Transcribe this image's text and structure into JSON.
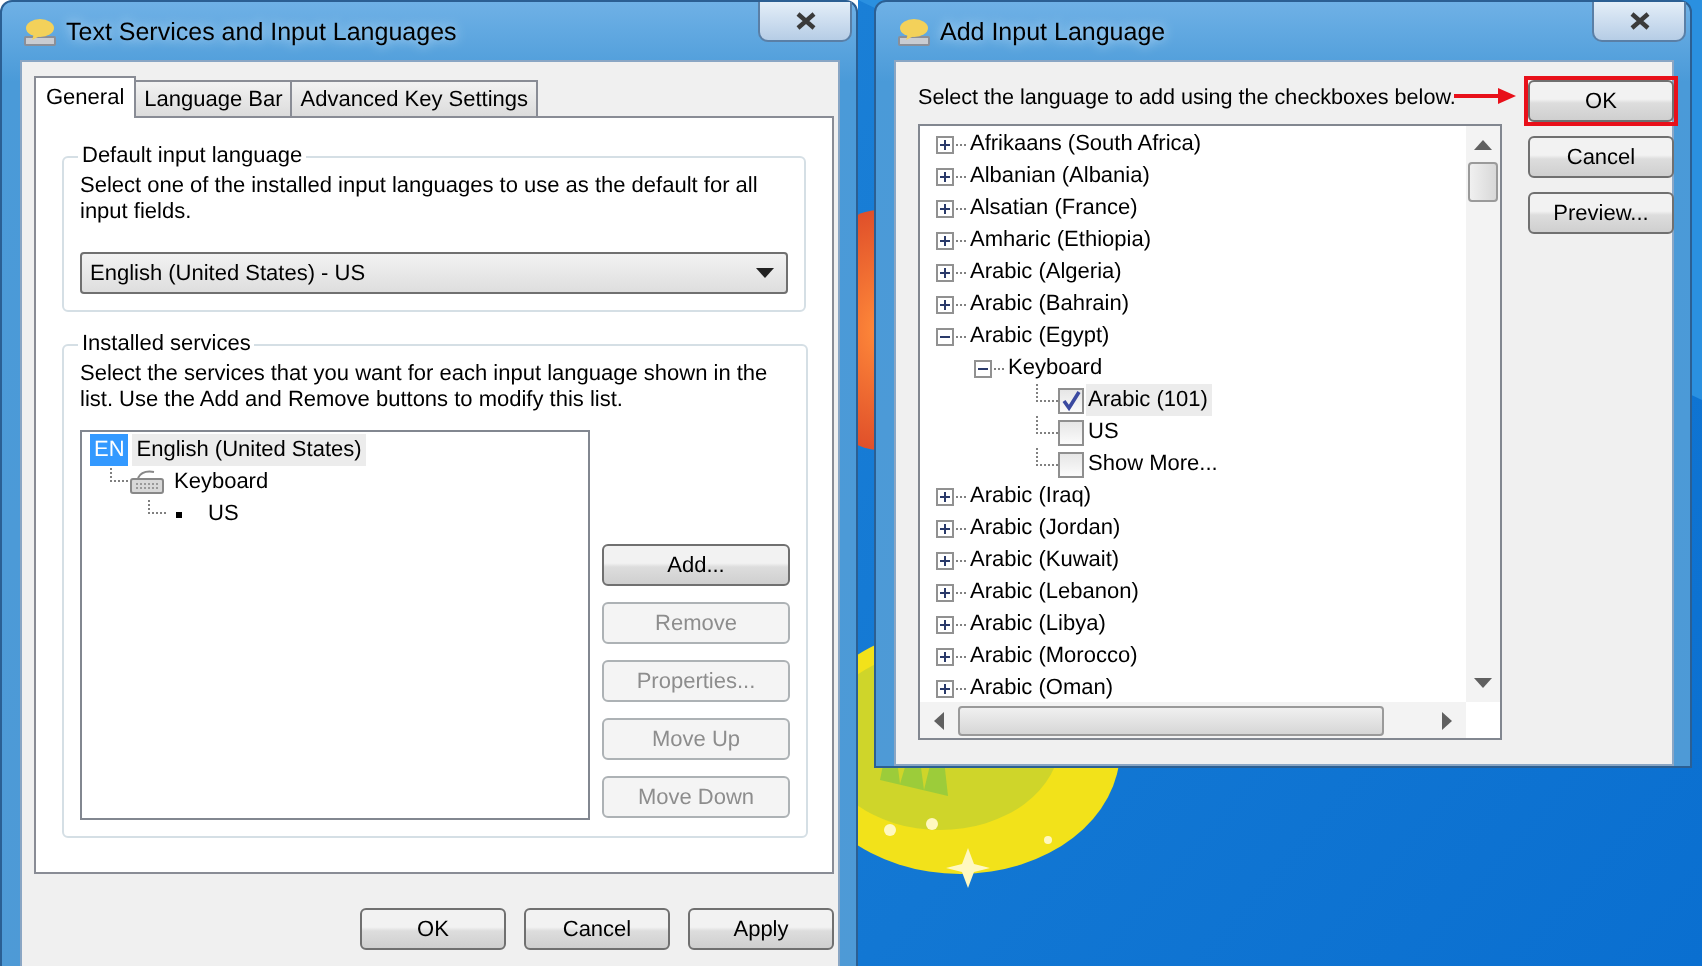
{
  "text_services_window": {
    "title": "Text Services and Input Languages",
    "tabs": [
      {
        "label": "General",
        "selected": true
      },
      {
        "label": "Language Bar",
        "selected": false
      },
      {
        "label": "Advanced Key Settings",
        "selected": false
      }
    ],
    "default_input_language": {
      "heading": "Default input language",
      "description": "Select one of the installed input languages to use as the default for all input fields.",
      "value": "English (United States) - US"
    },
    "installed_services": {
      "heading": "Installed services",
      "description": "Select the services that you want for each input language shown in the list. Use the Add and Remove buttons to modify this list.",
      "tree": [
        {
          "badge": "EN",
          "label": "English (United States)",
          "selected": true,
          "children": [
            {
              "kind": "category",
              "label": "Keyboard",
              "selected": false,
              "children": [
                {
                  "kind": "layout",
                  "label": "US",
                  "selected": false
                }
              ]
            }
          ]
        }
      ],
      "buttons": [
        {
          "label": "Add...",
          "disabled": false
        },
        {
          "label": "Remove",
          "disabled": true
        },
        {
          "label": "Properties...",
          "disabled": true
        },
        {
          "label": "Move Up",
          "disabled": true
        },
        {
          "label": "Move Down",
          "disabled": true
        }
      ]
    },
    "buttons": [
      {
        "label": "OK"
      },
      {
        "label": "Cancel"
      },
      {
        "label": "Apply"
      }
    ]
  },
  "add_language_window": {
    "title": "Add Input Language",
    "instruction": "Select the language to add using the checkboxes below.",
    "languages": [
      {
        "label": "Afrikaans (South Africa)",
        "expanded": false
      },
      {
        "label": "Albanian (Albania)",
        "expanded": false
      },
      {
        "label": "Alsatian (France)",
        "expanded": false
      },
      {
        "label": "Amharic (Ethiopia)",
        "expanded": false
      },
      {
        "label": "Arabic (Algeria)",
        "expanded": false
      },
      {
        "label": "Arabic (Bahrain)",
        "expanded": false
      },
      {
        "label": "Arabic (Egypt)",
        "expanded": true,
        "children": [
          {
            "label": "Keyboard",
            "expanded": true,
            "children": [
              {
                "kind": "checkbox",
                "label": "Arabic (101)",
                "checked": true,
                "selected": true
              },
              {
                "kind": "checkbox",
                "label": "US",
                "checked": false,
                "selected": false
              },
              {
                "kind": "checkbox",
                "label": "Show More...",
                "checked": false,
                "selected": false
              }
            ]
          }
        ]
      },
      {
        "label": "Arabic (Iraq)",
        "expanded": false
      },
      {
        "label": "Arabic (Jordan)",
        "expanded": false
      },
      {
        "label": "Arabic (Kuwait)",
        "expanded": false
      },
      {
        "label": "Arabic (Lebanon)",
        "expanded": false
      },
      {
        "label": "Arabic (Libya)",
        "expanded": false
      },
      {
        "label": "Arabic (Morocco)",
        "expanded": false
      },
      {
        "label": "Arabic (Oman)",
        "expanded": false
      }
    ],
    "buttons": [
      {
        "label": "OK",
        "highlighted": true
      },
      {
        "label": "Cancel",
        "highlighted": false
      },
      {
        "label": "Preview...",
        "highlighted": false
      }
    ]
  }
}
